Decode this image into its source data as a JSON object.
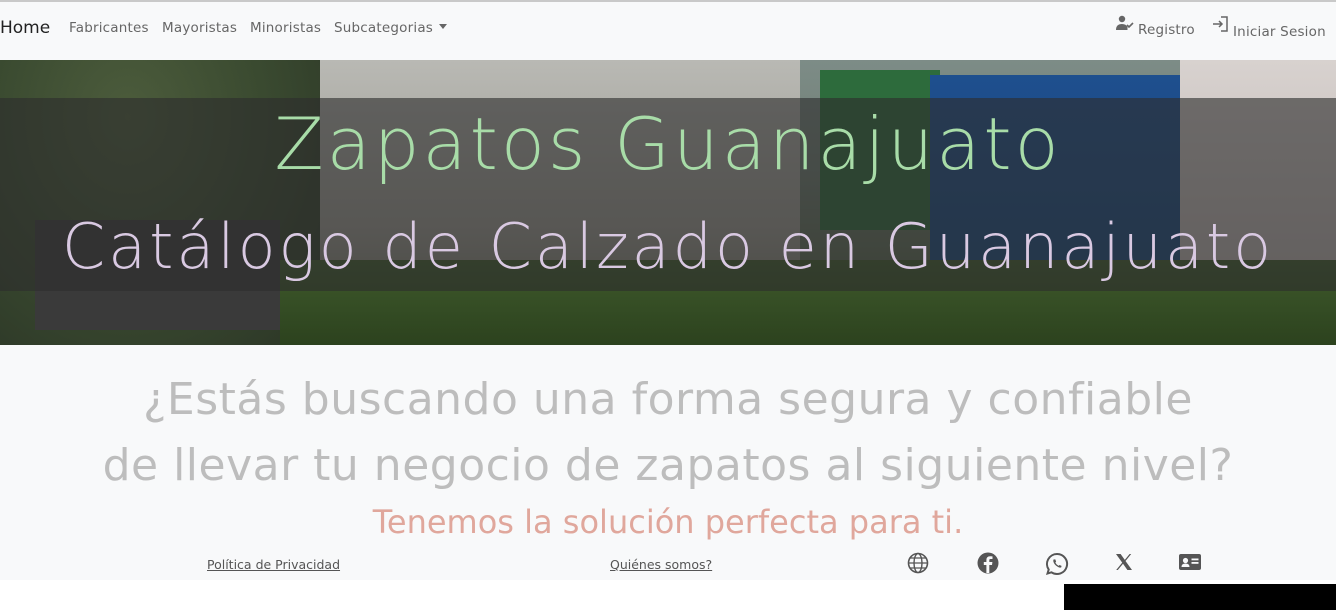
{
  "nav": {
    "home": "Home",
    "links": [
      "Fabricantes",
      "Mayoristas",
      "Minoristas"
    ],
    "dropdown": "Subcategorias",
    "register": "Registro",
    "login": "Iniciar Sesion"
  },
  "hero": {
    "title": "Zapatos Guanajuato",
    "subtitle": "Catálogo de Calzado en Guanajuato"
  },
  "main": {
    "question_line1": "¿Estás buscando una forma segura y confiable",
    "question_line2": "de llevar tu negocio de zapatos al siguiente nivel?",
    "solution": "Tenemos la solución perfecta para ti."
  },
  "footer": {
    "privacy": "Política de Privacidad",
    "about": "Quiénes somos?",
    "icons": [
      "globe-icon",
      "facebook-icon",
      "whatsapp-icon",
      "x-icon",
      "contact-card-icon"
    ]
  },
  "colors": {
    "title": "#a8dca8",
    "subtitle": "#d9c9e2",
    "question": "#bdbdbd",
    "solution": "#e0a79c",
    "navbar_bg": "#f8f9fa"
  }
}
